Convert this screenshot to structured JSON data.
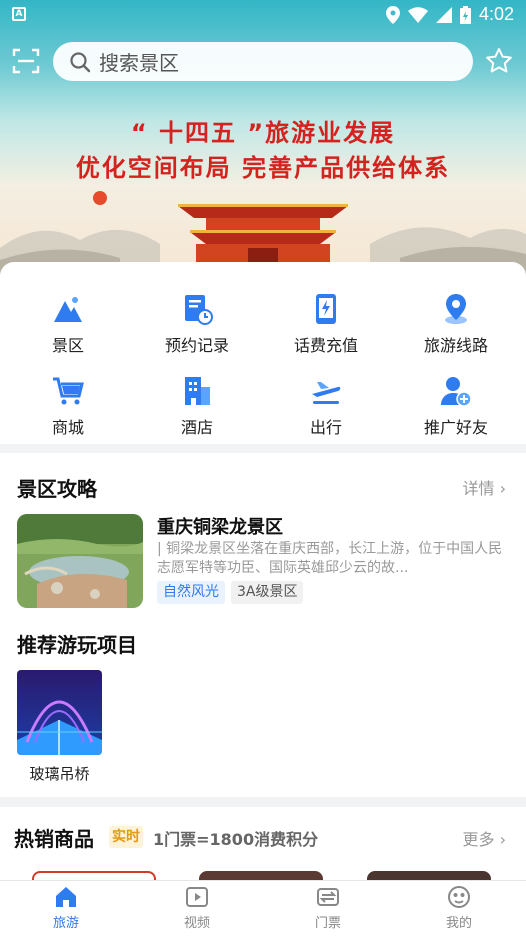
{
  "status_bar": {
    "time": "4:02",
    "left_badge": "A"
  },
  "search": {
    "placeholder": "搜索景区"
  },
  "banner": {
    "line1": "“ 十四五 ”旅游业发展",
    "line2": "优化空间布局  完善产品供给体系"
  },
  "menu": [
    {
      "label": "景区",
      "icon": "mountain-icon"
    },
    {
      "label": "预约记录",
      "icon": "record-icon"
    },
    {
      "label": "话费充值",
      "icon": "phone-charge-icon"
    },
    {
      "label": "旅游线路",
      "icon": "location-icon"
    },
    {
      "label": "商城",
      "icon": "cart-icon"
    },
    {
      "label": "酒店",
      "icon": "hotel-icon"
    },
    {
      "label": "出行",
      "icon": "plane-icon"
    },
    {
      "label": "推广好友",
      "icon": "add-friend-icon"
    }
  ],
  "guide": {
    "title": "景区攻略",
    "detail_label": "详情 ›",
    "scenic": {
      "name": "重庆铜梁龙景区",
      "desc": "| 铜梁龙景区坐落在重庆西部，长江上游，位于中国人民志愿军特等功臣、国际英雄邱少云的故...",
      "tags": [
        "自然风光",
        "3A级景区"
      ]
    },
    "project_title": "推荐游玩项目",
    "projects": [
      {
        "name": "玻璃吊桥"
      }
    ]
  },
  "hot": {
    "title": "热销商品",
    "badge": "实时",
    "note": "1门票=1800消费积分",
    "more_label": "更多 ›"
  },
  "tabs": [
    {
      "label": "旅游",
      "icon": "home-icon",
      "active": true
    },
    {
      "label": "视频",
      "icon": "video-icon",
      "active": false
    },
    {
      "label": "门票",
      "icon": "ticket-icon",
      "active": false
    },
    {
      "label": "我的",
      "icon": "profile-icon",
      "active": false
    }
  ],
  "colors": {
    "accent": "#2f7bf0",
    "banner_red": "#d4231e",
    "badge_orange": "#e49a13"
  }
}
